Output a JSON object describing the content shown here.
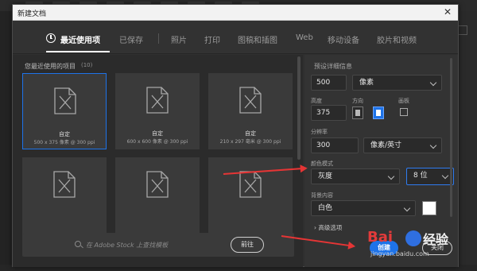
{
  "dialog": {
    "title": "新建文档",
    "close_glyph": "✕"
  },
  "tabs": [
    {
      "label": "最近使用项",
      "active": true
    },
    {
      "label": "已保存"
    },
    {
      "label": "照片"
    },
    {
      "label": "打印"
    },
    {
      "label": "图稿和插图"
    },
    {
      "label": "Web"
    },
    {
      "label": "移动设备"
    },
    {
      "label": "胶片和视频"
    }
  ],
  "recent": {
    "label": "您最近使用的项目",
    "count": "(10)",
    "cards": [
      {
        "name": "自定",
        "desc": "500 x 375 像素 @ 300 ppi",
        "selected": true
      },
      {
        "name": "自定",
        "desc": "600 x 600 像素 @ 300 ppi"
      },
      {
        "name": "自定",
        "desc": "210 x 297 毫米 @ 300 ppi"
      },
      {
        "name": "",
        "desc": ""
      },
      {
        "name": "",
        "desc": ""
      },
      {
        "name": "",
        "desc": ""
      }
    ]
  },
  "stock": {
    "placeholder": "在 Adobe Stock 上查找模板",
    "goto_label": "前往"
  },
  "preset": {
    "section_label": "预设详细信息",
    "width_value": "500",
    "width_unit": "像素",
    "height_label": "高度",
    "height_value": "375",
    "orientation_label": "方向",
    "artboard_label": "画板",
    "resolution_label": "分辨率",
    "resolution_value": "300",
    "resolution_unit": "像素/英寸",
    "color_mode_label": "颜色模式",
    "color_mode_value": "灰度",
    "bit_depth_value": "8 位",
    "background_label": "背景内容",
    "background_value": "白色",
    "background_color": "#ffffff",
    "advanced_label": "高级选项",
    "advanced_chevron": "›",
    "create_label": "创建",
    "close_label": "关闭"
  },
  "watermark": {
    "bai": "Bai",
    "jingyan": "经验",
    "url": "jingyan.baidu.com"
  },
  "colors": {
    "accent": "#1e73e8",
    "annotation_arrow": "#e53535"
  }
}
